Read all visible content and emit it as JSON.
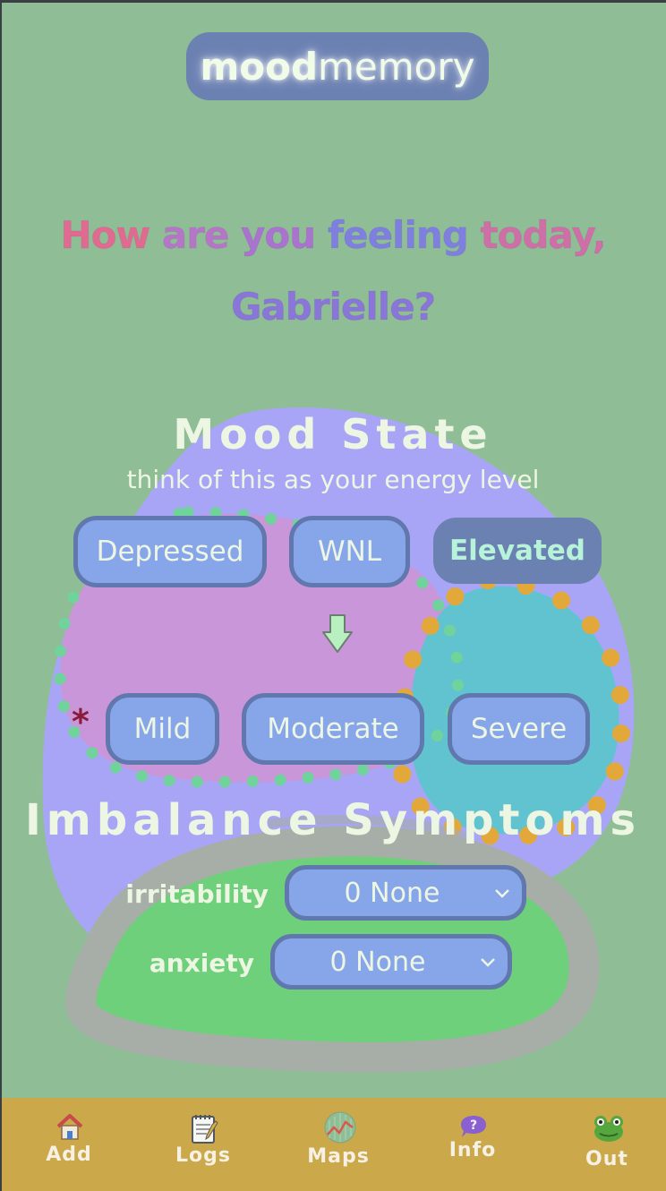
{
  "logo": {
    "bold": "mood",
    "light": "memory"
  },
  "greeting": {
    "line1": [
      {
        "text": "How ",
        "color": "#e16a93"
      },
      {
        "text": "are ",
        "color": "#b676c8"
      },
      {
        "text": "you ",
        "color": "#a973cf"
      },
      {
        "text": "feeling ",
        "color": "#7f7fe0"
      },
      {
        "text": "today,",
        "color": "#cf6fa8"
      }
    ],
    "line2": [
      {
        "text": "Gabrielle?",
        "color": "#8a75d8"
      }
    ]
  },
  "mood_state": {
    "title": "Mood State",
    "subtitle": "think of this as your energy level",
    "options": [
      "Depressed",
      "WNL",
      "Elevated"
    ],
    "selected": "Elevated"
  },
  "severity": {
    "required_marker": "*",
    "options": [
      "Mild",
      "Moderate",
      "Severe"
    ]
  },
  "imbalance": {
    "title": "Imbalance Symptoms",
    "symptoms": [
      {
        "label": "irritability",
        "value": "0 None"
      },
      {
        "label": "anxiety",
        "value": "0 None"
      }
    ]
  },
  "nav": {
    "items": [
      {
        "label": "Add",
        "icon": "house-icon"
      },
      {
        "label": "Logs",
        "icon": "notepad-icon"
      },
      {
        "label": "Maps",
        "icon": "chart-globe-icon"
      },
      {
        "label": "Info",
        "icon": "question-bubble-icon"
      },
      {
        "label": "Out",
        "icon": "frog-icon"
      }
    ]
  },
  "colors": {
    "background": "#8fbd95",
    "pill": "#87a6ea",
    "pill_border": "#6078ad",
    "pill_selected": "#6b81b2",
    "nav": "#cba84a"
  }
}
